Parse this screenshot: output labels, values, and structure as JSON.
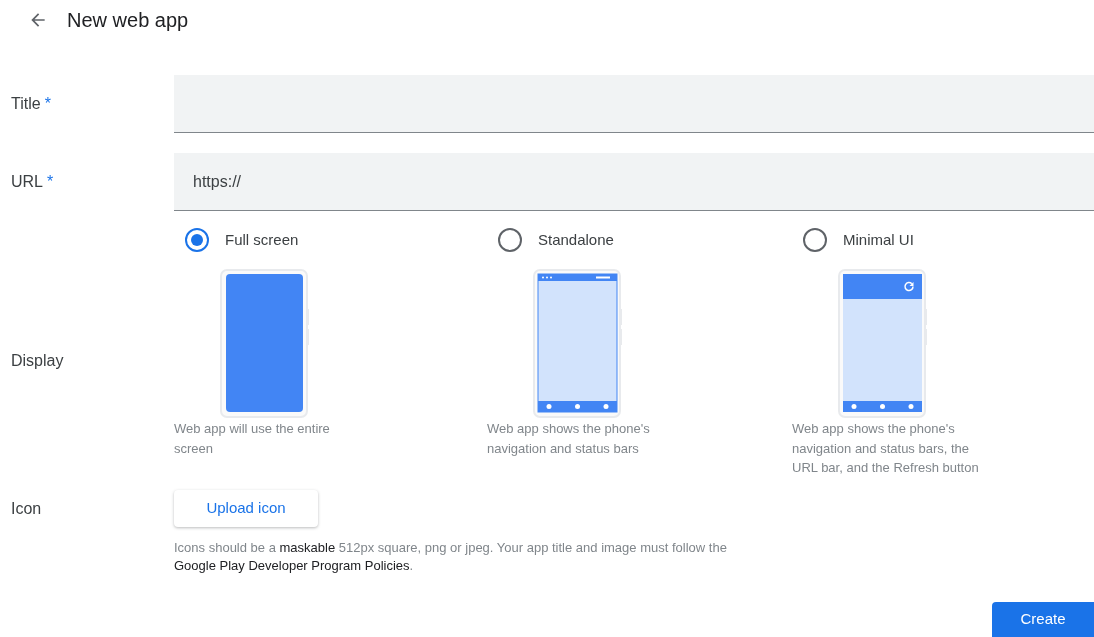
{
  "header": {
    "title": "New web app"
  },
  "fields": [
    {
      "label": "Title",
      "required_mark": "*"
    },
    {
      "label": "URL",
      "required_mark": "*",
      "value": "https://"
    }
  ],
  "display": {
    "label": "Display",
    "options": [
      {
        "label": "Full screen",
        "selected": true,
        "kind": "fullscreen",
        "description": "Web app will use the entire screen"
      },
      {
        "label": "Standalone",
        "selected": false,
        "kind": "standalone",
        "description": "Web app shows the phone's navigation and status bars"
      },
      {
        "label": "Minimal UI",
        "selected": false,
        "kind": "minimal",
        "description": "Web app shows the phone's navigation and status bars, the URL bar, and the Refresh button"
      }
    ]
  },
  "icon": {
    "label": "Icon",
    "button": "Upload icon",
    "help": [
      {
        "kind": "text",
        "text": "Icons should be a "
      },
      {
        "kind": "link",
        "text": "maskable"
      },
      {
        "kind": "text",
        "text": " 512px square, png or jpeg. Your app title and image must follow the "
      },
      {
        "kind": "link",
        "text": "Google Play Developer Program Policies"
      },
      {
        "kind": "text",
        "text": "."
      }
    ]
  },
  "create_button": "Create"
}
